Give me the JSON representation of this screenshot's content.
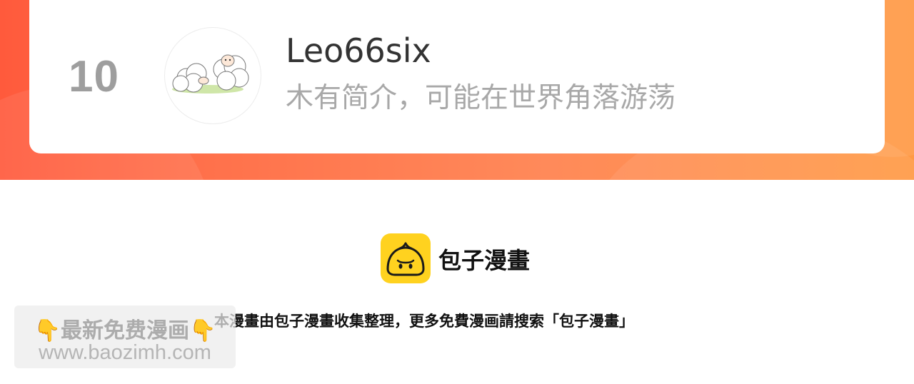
{
  "ranking": {
    "rank": "10",
    "username": "Leo66six",
    "bio": "木有简介，可能在世界角落游荡",
    "avatar_icon": "sheep-avatar-icon"
  },
  "colors": {
    "band_start": "#ff5a3c",
    "band_end": "#ff9a45",
    "rank_gray": "#9e9e9e",
    "logo_yellow": "#ffd21f"
  },
  "footer": {
    "brand_icon": "baozi-logo-icon",
    "brand_name": "包子漫畫",
    "notice": "本漫畫由包子漫畫收集整理，更多免費漫画請搜索「包子漫畫」"
  },
  "watermark": {
    "line1": "最新免费漫画",
    "hand_icon": "pointing-down-icon",
    "line2": "www.baozimh.com"
  }
}
